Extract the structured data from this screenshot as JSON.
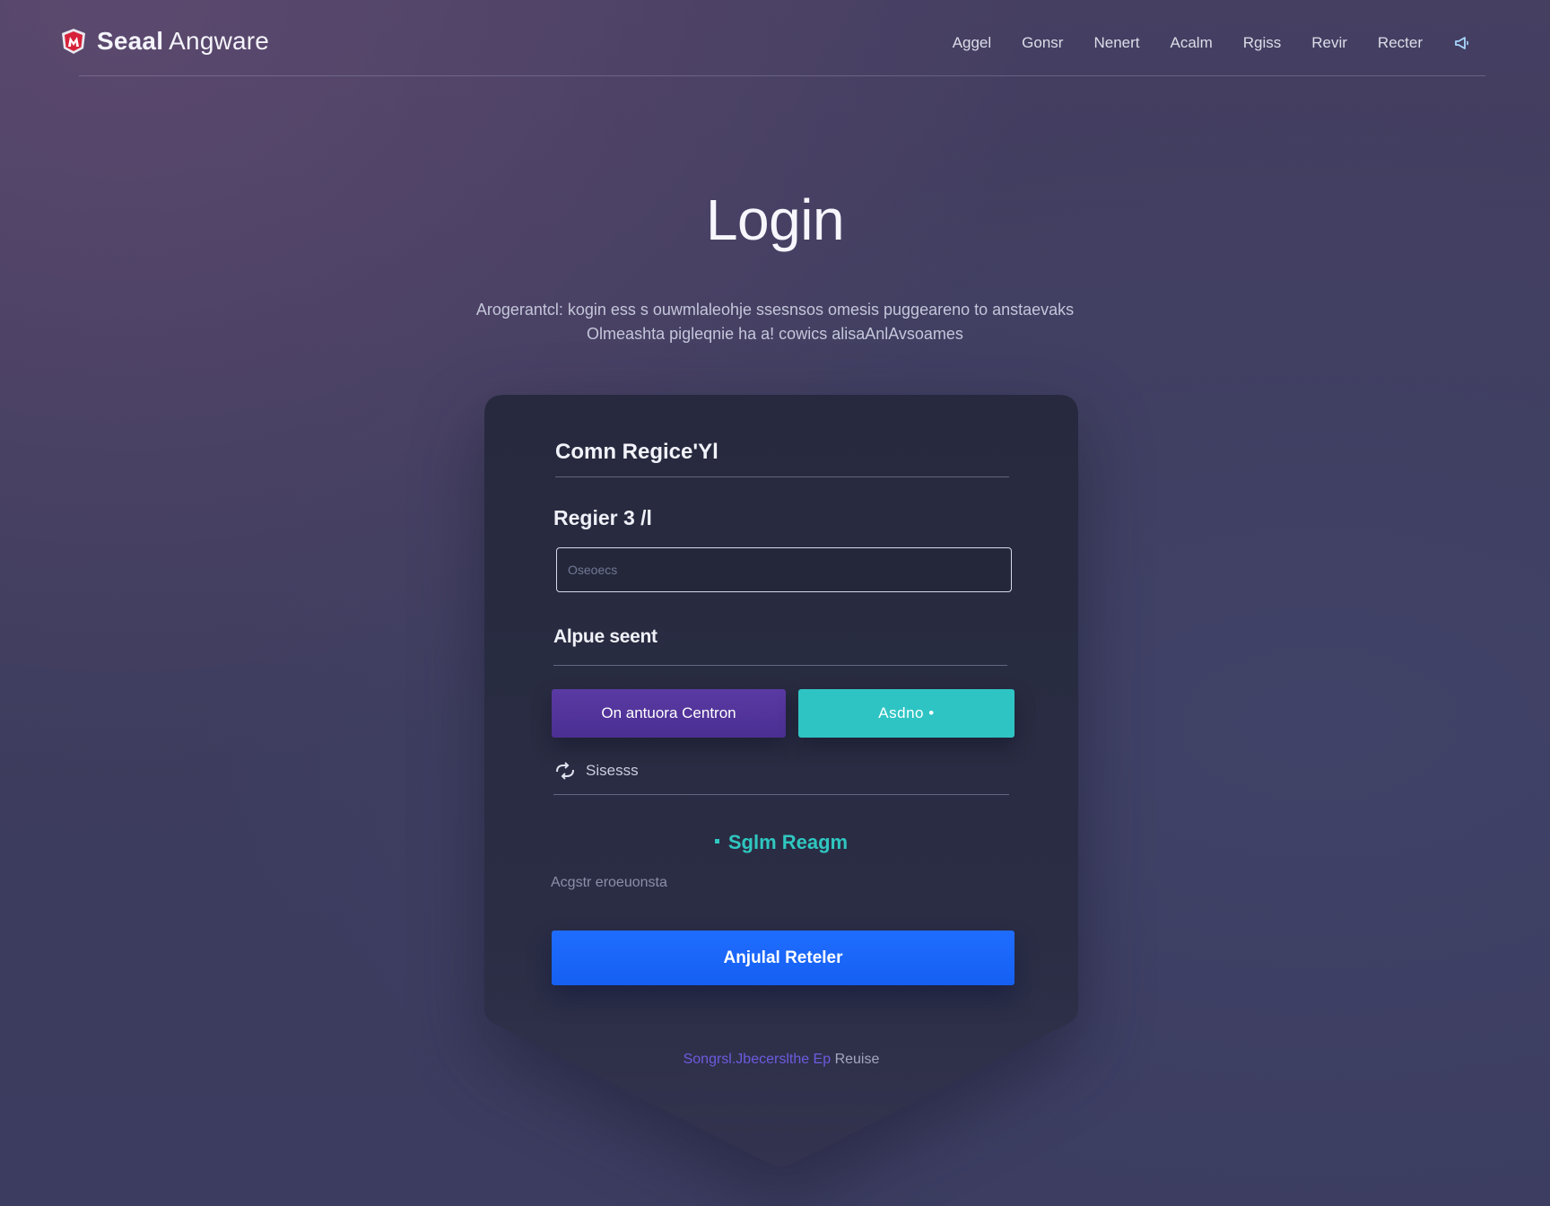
{
  "header": {
    "brand_primary": "Seaal",
    "brand_secondary": "Angware",
    "nav": [
      "Aggel",
      "Gonsr",
      "Nenert",
      "Acalm",
      "Rgiss",
      "Revir",
      "Recter"
    ],
    "nav_icon": "megaphone-icon"
  },
  "hero": {
    "title": "Login",
    "subtitle": "Arogerantcl: kogin ess s ouwmlaleohje ssesnsos omesis puggeareno to anstaevaks Olmeashta pigleqnie ha a! cowics alisaAnlAvsoames"
  },
  "card": {
    "heading": "Comn Regice'Yl",
    "field_label": "Regier 3 /l",
    "input": {
      "placeholder": "Oseoecs",
      "value": ""
    },
    "section_label": "Alpue seent",
    "primary_purple_button": "On antuora Centron",
    "teal_button": "Asdno •",
    "status": {
      "icon": "sync-icon",
      "text": "Sisesss"
    },
    "teal_link": "Sglm Reagm",
    "helper_text": "Acgstr eroeuonsta",
    "submit_button": "Anjulal Reteler",
    "footer_link": {
      "accent_text": "Songrsl.Jbecerslthe Ep",
      "plain_text": "Reuise"
    }
  },
  "colors": {
    "background": "#3e3d5e",
    "card": "#262a3e",
    "purple": "#5338a0",
    "teal": "#2fc4c4",
    "blue": "#1a66fa",
    "brand_red": "#d7223a"
  }
}
